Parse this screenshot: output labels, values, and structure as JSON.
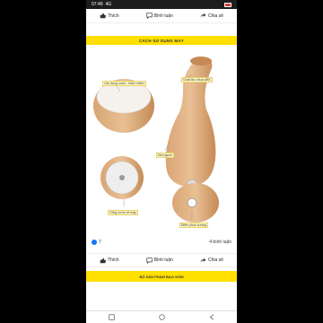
{
  "status": {
    "time": "07:49",
    "signal_text": "4G"
  },
  "actions": {
    "like": "Thích",
    "comment": "Bình luận",
    "share": "Chia sẻ"
  },
  "post": {
    "banner_title": "CÁCH SỬ DỤNG MÁY",
    "labels": {
      "lid": "Chất liệu nhựa ABS",
      "base_cover": "Các dụng nước - thiên nhiên",
      "power": "Nút nguồn",
      "bottom": "Cổng nước về máy",
      "water_level": "Điểm phun sương"
    }
  },
  "meta": {
    "likes": "7",
    "comments": "4 bình luận"
  },
  "banner2": "BỘ SẢN PHẨM BAO GỒM",
  "colors": {
    "accent": "#ffe000",
    "like_blue": "#1877f2"
  }
}
